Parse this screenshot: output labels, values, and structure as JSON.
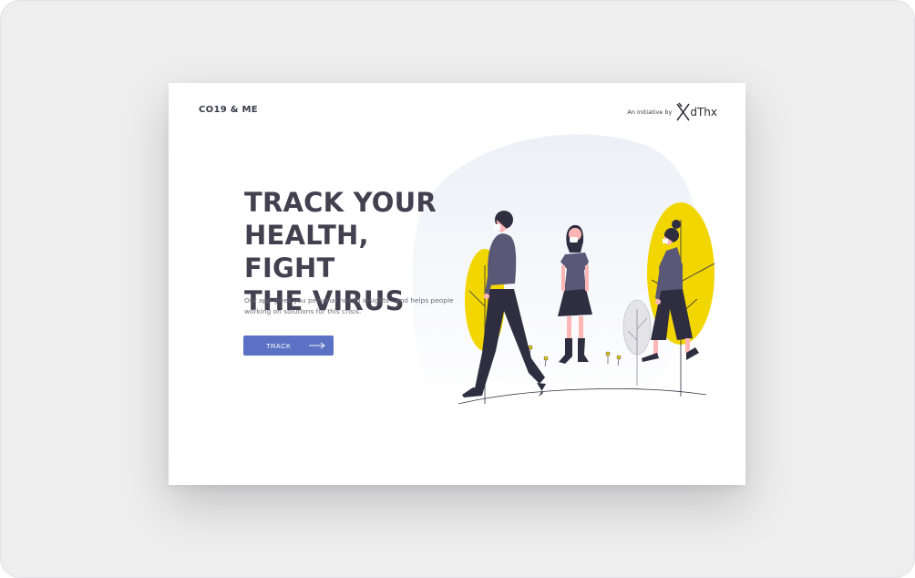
{
  "header": {
    "logo": "CO19 & ME",
    "initiative_text": "An initiative by",
    "brand_name": "dThx"
  },
  "hero": {
    "headline_lines": [
      "TRACK YOUR",
      "HEALTH, FIGHT",
      "THE VIRUS"
    ],
    "description": "Our app gives you personal health insights - and helps people working on solutions for this crisis.",
    "cta_label": "TRACK"
  },
  "colors": {
    "accent": "#5b72c4",
    "headline": "#43414f",
    "tree_yellow": "#f2d600",
    "figure_purple": "#5a5877",
    "figure_dark": "#2f2e41"
  }
}
